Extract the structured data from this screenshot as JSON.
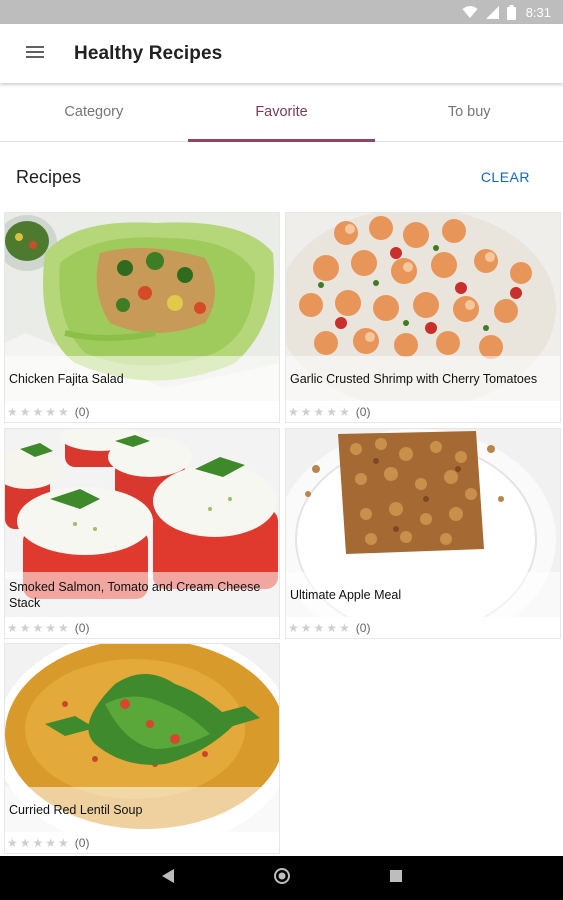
{
  "status": {
    "time": "8:31"
  },
  "app_bar": {
    "title": "Healthy Recipes",
    "menu_icon": "hamburger-menu-icon"
  },
  "tabs": [
    {
      "label": "Category",
      "active": false
    },
    {
      "label": "Favorite",
      "active": true
    },
    {
      "label": "To buy",
      "active": false
    }
  ],
  "section": {
    "title": "Recipes",
    "clear_label": "CLEAR"
  },
  "recipes": [
    {
      "title": "Chicken Fajita Salad",
      "count": "(0)",
      "rating": 0,
      "stars": "★★★★★"
    },
    {
      "title": "Garlic Crusted Shrimp with Cherry Tomatoes",
      "count": "(0)",
      "rating": 0,
      "stars": "★★★★★"
    },
    {
      "title": "Smoked Salmon, Tomato and Cream Cheese Stack",
      "count": "(0)",
      "rating": 0,
      "stars": "★★★★★"
    },
    {
      "title": "Ultimate Apple Meal",
      "count": "(0)",
      "rating": 0,
      "stars": "★★★★★"
    },
    {
      "title": "Curried Red Lentil Soup",
      "count": "(0)",
      "rating": 0,
      "stars": "★★★★★"
    }
  ],
  "colors": {
    "accent": "#8a4a66",
    "clear": "#1565c0",
    "status_bar": "#bdbdbd"
  }
}
